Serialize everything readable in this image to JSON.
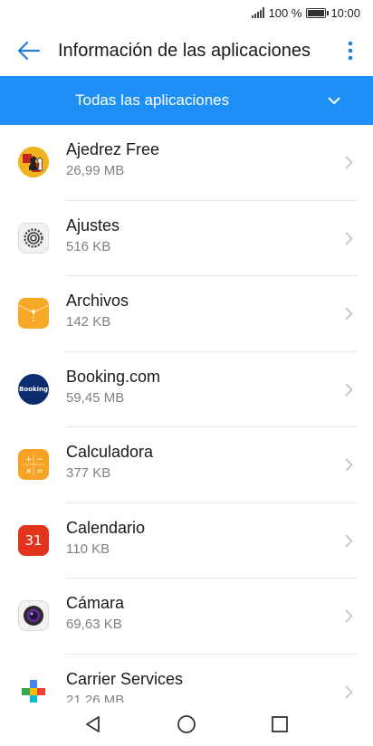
{
  "status_bar": {
    "battery_percent": "100 %",
    "time": "10:00",
    "signal_icon": "signal-icon",
    "battery_icon": "battery-icon"
  },
  "header": {
    "title": "Información de las aplicaciones",
    "back_icon": "arrow-back-icon",
    "more_icon": "more-vert-icon"
  },
  "filter": {
    "label": "Todas las aplicaciones",
    "icon": "chevron-down-icon"
  },
  "apps": [
    {
      "name": "Ajedrez Free",
      "size": "26,99 MB",
      "icon": "chess-icon"
    },
    {
      "name": "Ajustes",
      "size": "516 KB",
      "icon": "settings-icon"
    },
    {
      "name": "Archivos",
      "size": "142 KB",
      "icon": "files-icon"
    },
    {
      "name": "Booking.com",
      "size": "59,45 MB",
      "icon": "booking-icon",
      "icon_text": "Booking"
    },
    {
      "name": "Calculadora",
      "size": "377 KB",
      "icon": "calculator-icon"
    },
    {
      "name": "Calendario",
      "size": "110 KB",
      "icon": "calendar-icon",
      "icon_text": "31"
    },
    {
      "name": "Cámara",
      "size": "69,63 KB",
      "icon": "camera-icon"
    },
    {
      "name": "Carrier Services",
      "size": "21,26 MB",
      "icon": "carrier-services-icon"
    }
  ],
  "nav": {
    "back_icon": "nav-back-icon",
    "home_icon": "nav-home-icon",
    "recents_icon": "nav-recents-icon"
  },
  "colors": {
    "accent": "#1e90f5",
    "back_arrow": "#1e7fe0"
  }
}
